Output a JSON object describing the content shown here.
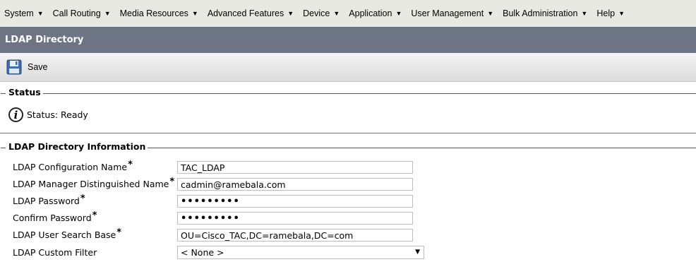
{
  "menu": [
    {
      "label": "System",
      "icon": "triangle-down-icon"
    },
    {
      "label": "Call Routing",
      "icon": "triangle-down-icon"
    },
    {
      "label": "Media Resources",
      "icon": "triangle-down-icon"
    },
    {
      "label": "Advanced Features",
      "icon": "triangle-down-icon"
    },
    {
      "label": "Device",
      "icon": "triangle-down-icon"
    },
    {
      "label": "Application",
      "icon": "triangle-down-icon"
    },
    {
      "label": "User Management",
      "icon": "triangle-down-icon"
    },
    {
      "label": "Bulk Administration",
      "icon": "triangle-down-icon"
    },
    {
      "label": "Help",
      "icon": "triangle-down-icon"
    }
  ],
  "page": {
    "title": "LDAP Directory"
  },
  "toolbar": {
    "save_label": "Save",
    "save_icon": "floppy-disk-icon"
  },
  "status": {
    "legend": "Status",
    "text": "Status: Ready",
    "icon": "info-icon"
  },
  "ldap": {
    "legend": "LDAP Directory Information",
    "required_mark": "*",
    "fields": [
      {
        "label": "LDAP Configuration Name",
        "required": true,
        "value": "TAC_LDAP"
      },
      {
        "label": "LDAP Manager Distinguished Name",
        "required": true,
        "value": "cadmin@ramebala.com"
      },
      {
        "label": "LDAP Password",
        "required": true,
        "value": "•••••••••"
      },
      {
        "label": "Confirm Password",
        "required": true,
        "value": "•••••••••"
      },
      {
        "label": "LDAP User Search Base",
        "required": true,
        "value": "OU=Cisco_TAC,DC=ramebala,DC=com"
      },
      {
        "label": "LDAP Custom Filter",
        "required": false,
        "value": "< None >"
      }
    ]
  },
  "colors": {
    "menubar_bg": "#e9e9e3",
    "titlebar_bg": "#6d7484"
  }
}
